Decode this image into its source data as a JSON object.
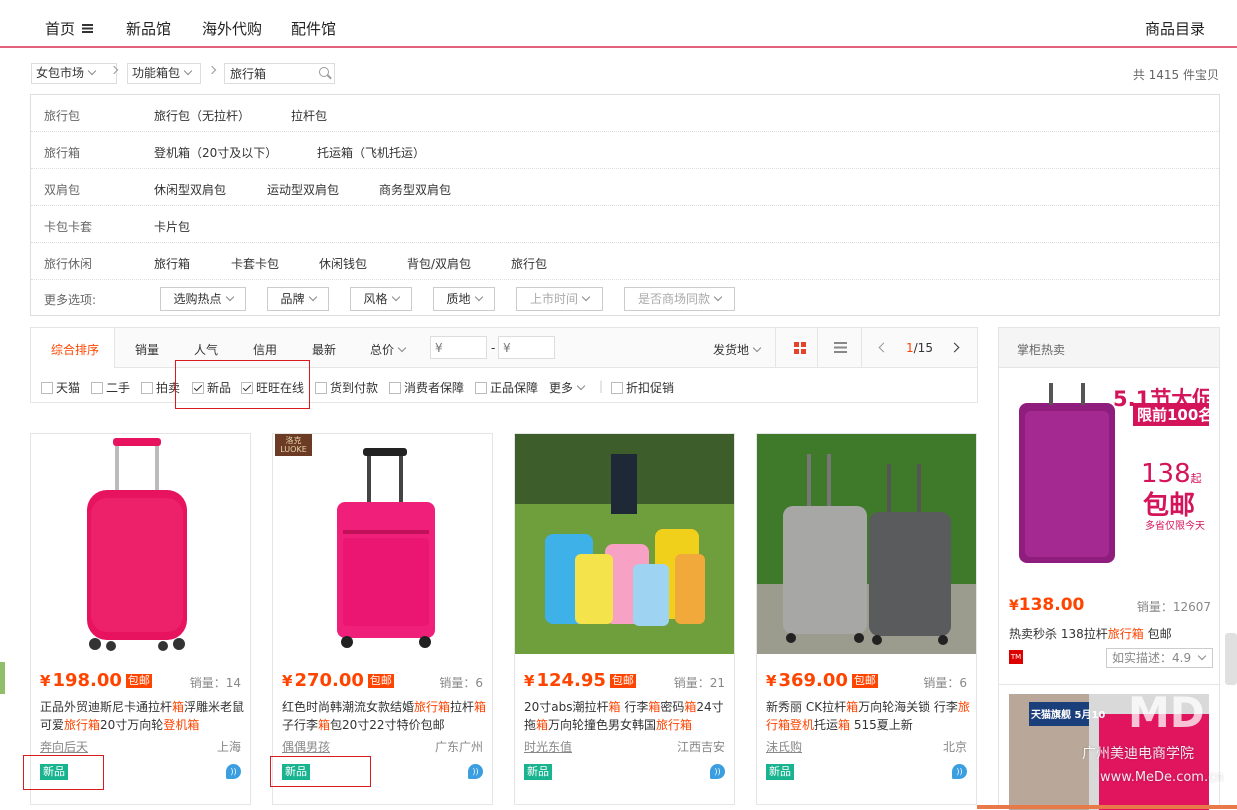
{
  "topnav": {
    "home": "首页",
    "items": [
      "新品馆",
      "海外代购",
      "配件馆"
    ],
    "catalog": "商品目录"
  },
  "breadcrumb": {
    "items": [
      "女包市场",
      "功能箱包"
    ],
    "search_value": "旅行箱"
  },
  "total_text": "共 1415 件宝贝",
  "categories": [
    {
      "label": "旅行包",
      "items": [
        "旅行包（无拉杆）",
        "拉杆包"
      ]
    },
    {
      "label": "旅行箱",
      "items": [
        "登机箱（20寸及以下）",
        "托运箱（飞机托运）"
      ]
    },
    {
      "label": "双肩包",
      "items": [
        "休闲型双肩包",
        "运动型双肩包",
        "商务型双肩包"
      ]
    },
    {
      "label": "卡包卡套",
      "items": [
        "卡片包"
      ]
    },
    {
      "label": "旅行休闲",
      "items": [
        "旅行箱",
        "卡套卡包",
        "休闲钱包",
        "背包/双肩包",
        "旅行包"
      ]
    }
  ],
  "more_options": {
    "label": "更多选项:",
    "buttons": [
      "选购热点",
      "品牌",
      "风格",
      "质地",
      "上市时间",
      "是否商场同款"
    ]
  },
  "sort": {
    "items": [
      "综合排序",
      "销量",
      "人气",
      "信用",
      "最新",
      "总价"
    ],
    "price_from_placeholder": "¥",
    "price_to_placeholder": "¥",
    "dash": "-",
    "ship_from": "发货地",
    "page_current": "1",
    "page_total": "/15"
  },
  "filters": [
    {
      "label": "天猫",
      "checked": false
    },
    {
      "label": "二手",
      "checked": false
    },
    {
      "label": "拍卖",
      "checked": false
    },
    {
      "label": "新品",
      "checked": true
    },
    {
      "label": "旺旺在线",
      "checked": true
    },
    {
      "label": "货到付款",
      "checked": false
    },
    {
      "label": "消费者保障",
      "checked": false
    },
    {
      "label": "正品保障",
      "checked": false
    }
  ],
  "filters_more": "更多",
  "filter_discount": "折扣促销",
  "products": [
    {
      "price": "198.00",
      "baoyou": "包邮",
      "sales": "销量：14",
      "title_html": "正品外贸迪斯尼卡通拉杆<span class='hl'>箱</span>浮雕米老鼠可爱<span class='hl'>旅行箱</span>20寸万向轮<span class='hl'>登机箱</span>",
      "shop": "奔向后天",
      "location": "上海",
      "badge": "新品",
      "colors": {
        "bag": "#e8135f"
      }
    },
    {
      "price": "270.00",
      "baoyou": "包邮",
      "sales": "销量：6",
      "title_html": "红色时尚韩潮流女款结婚<span class='hl'>旅行箱</span>拉杆<span class='hl'>箱</span>子行李<span class='hl'>箱</span>包20寸22寸特价包邮",
      "shop": "偶偶男孩",
      "location": "广东广州",
      "badge": "新品",
      "brand_tag": "洛克 LUOKE",
      "colors": {
        "bag": "#f0207a"
      }
    },
    {
      "price": "124.95",
      "baoyou": "包邮",
      "sales": "销量：21",
      "title_html": "20寸abs潮拉杆<span class='hl'>箱</span> 行李<span class='hl'>箱</span>密码<span class='hl'>箱</span>24寸拖<span class='hl'>箱</span>万向轮撞色男女韩国<span class='hl'>旅行箱</span>",
      "shop": "时光东值",
      "location": "江西吉安",
      "badge": "新品"
    },
    {
      "price": "369.00",
      "baoyou": "包邮",
      "sales": "销量：6",
      "title_html": "新秀丽 CK拉杆<span class='hl'>箱</span>万向轮海关锁 行李<span class='hl'>旅行箱登机</span>托运<span class='hl'>箱</span> 515夏上新",
      "shop": "沫氏购",
      "location": "北京",
      "badge": "新品"
    }
  ],
  "right_panel": {
    "header": "掌柜热卖",
    "ad_headline": "5.1节大促",
    "ad_sub": "限前100名",
    "ad_price": "138",
    "ad_qi": "起",
    "ad_baoyou": "包邮",
    "ad_note": "多省仅限今天",
    "price": "138.00",
    "sales": "销量：12607",
    "title_html": "热卖秒杀 138拉杆<span class='hl'>旅行箱</span> 包邮",
    "rating": "如实描述：4.9",
    "ad2_text": "天猫旗舰 5月10"
  },
  "watermark": {
    "line1": "广州美迪电商学院",
    "line2": "www.MeDe.com.cn",
    "logo": "MD"
  },
  "colors": {
    "accent": "#ff4400",
    "nav_line": "#e4627b",
    "badge": "#1ab38f",
    "annot": "#d61c1c"
  }
}
